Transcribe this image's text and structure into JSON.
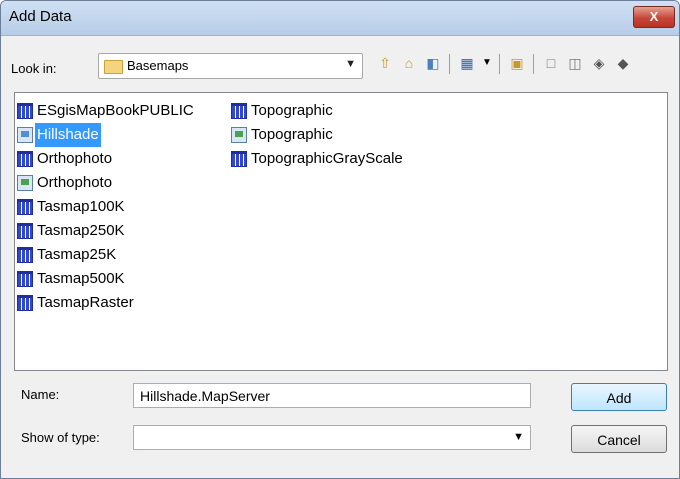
{
  "window": {
    "title": "Add Data",
    "close_label": "X"
  },
  "toolbar": {
    "look_in_label": "Look in:",
    "look_in_value": "Basemaps",
    "icons": [
      "up-folder",
      "home",
      "connect",
      "view-menu",
      "new-folder",
      "toolbar-a",
      "toolbar-b",
      "toolbar-c",
      "toolbar-d"
    ]
  },
  "files": {
    "col1": [
      {
        "label": "ESgisMapBookPUBLIC",
        "icon": "grid"
      },
      {
        "label": "Hillshade",
        "icon": "server",
        "selected": true
      },
      {
        "label": "Orthophoto",
        "icon": "grid"
      },
      {
        "label": "Orthophoto",
        "icon": "server-green"
      },
      {
        "label": "Tasmap100K",
        "icon": "grid"
      },
      {
        "label": "Tasmap250K",
        "icon": "grid"
      },
      {
        "label": "Tasmap25K",
        "icon": "grid"
      },
      {
        "label": "Tasmap500K",
        "icon": "grid"
      },
      {
        "label": "TasmapRaster",
        "icon": "grid"
      }
    ],
    "col2": [
      {
        "label": "Topographic",
        "icon": "grid"
      },
      {
        "label": "Topographic",
        "icon": "server-green"
      },
      {
        "label": "TopographicGrayScale",
        "icon": "grid"
      }
    ]
  },
  "form": {
    "name_label": "Name:",
    "name_value": "Hillshade.MapServer",
    "type_label": "Show of type:",
    "type_value": ""
  },
  "buttons": {
    "add": "Add",
    "cancel": "Cancel"
  }
}
